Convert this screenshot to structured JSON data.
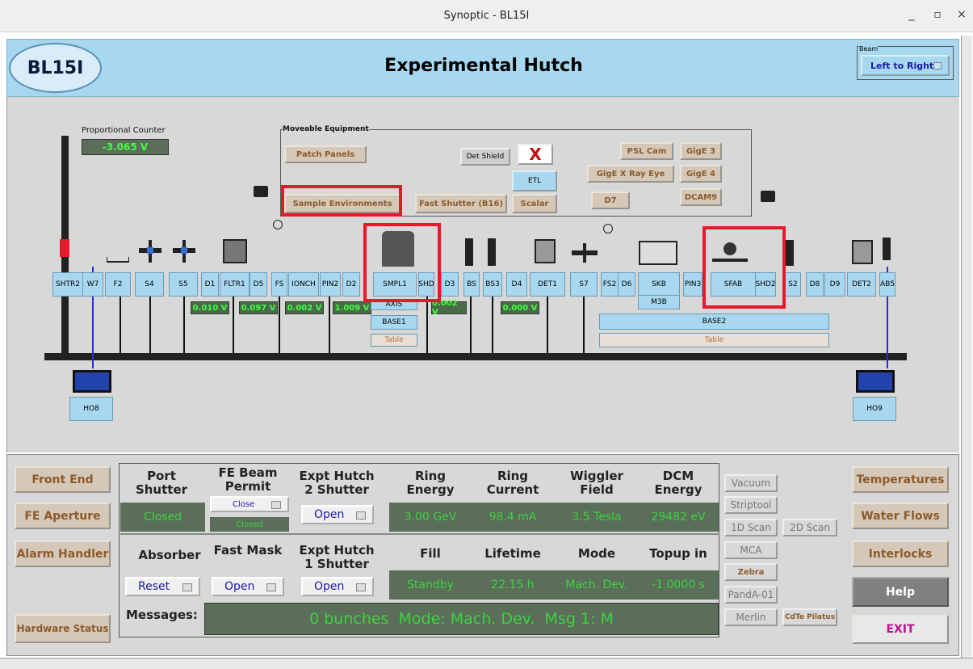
{
  "window": {
    "title": "Synoptic - BL15I",
    "minimize": "_",
    "maximize": "▫",
    "close": "×"
  },
  "header": {
    "beamline": "BL15I",
    "title": "Experimental Hutch",
    "beam_group": "Beam",
    "beam_direction": "Left to Right"
  },
  "counter": {
    "label": "Proportional Counter",
    "value": "-3.065 V"
  },
  "moveable": {
    "title": "Moveable Equipment",
    "patch": "Patch Panels",
    "sample_env": "Sample Environments",
    "fast_shutter": "Fast Shutter (B16)",
    "scalar": "Scalar",
    "det_shield": "Det Shield",
    "etl": "ETL",
    "psl": "PSL Cam",
    "gige3": "GigE 3",
    "gigexray": "GigE X Ray Eye",
    "gige4": "GigE 4",
    "d7": "D7",
    "dcam9": "DCAM9"
  },
  "components": [
    "SHTR2",
    "W7",
    "F2",
    "S4",
    "S5",
    "D1",
    "FLTR1",
    "D5",
    "FS",
    "IONCH",
    "PIN2",
    "D2",
    "SMPL1",
    "SHD",
    "D3",
    "BS",
    "BS3",
    "D4",
    "DET1",
    "S7",
    "FS2",
    "D6",
    "SKB",
    "PIN3",
    "SFAB",
    "SHD2",
    "S2",
    "D8",
    "D9",
    "DET2",
    "AB5"
  ],
  "stage": {
    "base1": "BASE1",
    "table1": "Table",
    "axis": "AXIS",
    "m3b": "M3B",
    "base2": "BASE2",
    "table2": "Table",
    "ho8": "HO8",
    "ho9": "HO9"
  },
  "readings": [
    "0.010 V",
    "0.097 V",
    "0.002 V",
    "1.009 V",
    "0.002 V",
    "0.000 V"
  ],
  "left_buttons": [
    "Front End",
    "FE Aperture",
    "Alarm Handler",
    "Hardware Status"
  ],
  "status": {
    "port_shutter": {
      "label": "Port Shutter",
      "value": "Closed"
    },
    "fe_beam": {
      "label": "FE Beam Permit",
      "button": "Close",
      "value": "Closed"
    },
    "expt2": {
      "label": "Expt Hutch 2 Shutter",
      "button": "Open"
    },
    "ring_energy": {
      "label": "Ring Energy",
      "value": "3.00 GeV"
    },
    "ring_current": {
      "label": "Ring Current",
      "value": "98.4 mA"
    },
    "wiggler": {
      "label": "Wiggler Field",
      "value": "3.5 Tesla"
    },
    "dcm": {
      "label": "DCM Energy",
      "value": "29482 eV"
    },
    "absorber": {
      "label": "Absorber",
      "button": "Reset"
    },
    "fast_mask": {
      "label": "Fast Mask",
      "button": "Open"
    },
    "expt1": {
      "label": "Expt Hutch 1 Shutter",
      "button": "Open"
    },
    "fill": {
      "label": "Fill",
      "value": "Standby"
    },
    "lifetime": {
      "label": "Lifetime",
      "value": "22.15 h"
    },
    "mode": {
      "label": "Mode",
      "value": "Mach. Dev."
    },
    "topup": {
      "label": "Topup in",
      "value": "-1.0000 s"
    },
    "messages_label": "Messages:",
    "messages": "0 bunches  Mode: Mach. Dev.  Msg 1: M"
  },
  "tools": {
    "vacuum": "Vacuum",
    "striptool": "Striptool",
    "scan1d": "1D Scan",
    "scan2d": "2D Scan",
    "mca": "MCA",
    "zebra": "Zebra",
    "panda": "PandA-01",
    "merlin": "Merlin",
    "cdte": "CdTe Pilatus"
  },
  "right_buttons": {
    "temps": "Temperatures",
    "water": "Water Flows",
    "interlocks": "Interlocks",
    "help": "Help",
    "exit": "EXIT"
  }
}
